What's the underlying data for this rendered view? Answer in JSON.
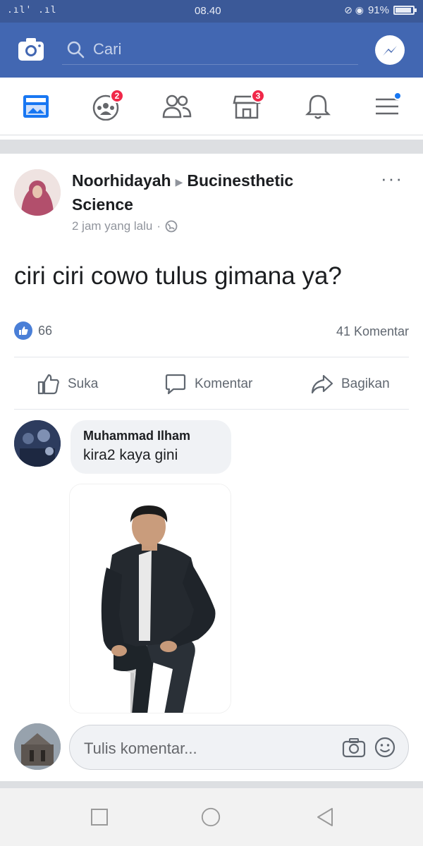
{
  "status_bar": {
    "signal": "3il 3il",
    "time": "08.40",
    "battery": "91%"
  },
  "header": {
    "search_placeholder": "Cari",
    "camera_icon": "camera-icon",
    "messenger_icon": "messenger-icon"
  },
  "tabs": [
    {
      "name": "news-feed",
      "icon": "news-feed-icon",
      "badge": ""
    },
    {
      "name": "groups",
      "icon": "groups-icon",
      "badge": "2"
    },
    {
      "name": "friends",
      "icon": "friends-icon",
      "badge": ""
    },
    {
      "name": "marketplace",
      "icon": "marketplace-icon",
      "badge": "3"
    },
    {
      "name": "notifications",
      "icon": "bell-icon",
      "badge": ""
    },
    {
      "name": "menu",
      "icon": "menu-icon",
      "badge": ""
    }
  ],
  "post": {
    "author": "Noorhidayah",
    "group": "Bucinesthetic Science",
    "time": "2 jam yang lalu",
    "text": "ciri ciri cowo tulus gimana ya?",
    "likes": "66",
    "comments": "41 Komentar",
    "actions": {
      "like": "Suka",
      "comment": "Komentar",
      "share": "Bagikan"
    }
  },
  "comment": {
    "author": "Muhammad Ilham",
    "text": "kira2 kaya gini"
  },
  "compose": {
    "placeholder": "Tulis komentar..."
  },
  "colors": {
    "brand_blue": "#4267b2",
    "status_blue": "#3b5998",
    "badge_red": "#f02849"
  }
}
